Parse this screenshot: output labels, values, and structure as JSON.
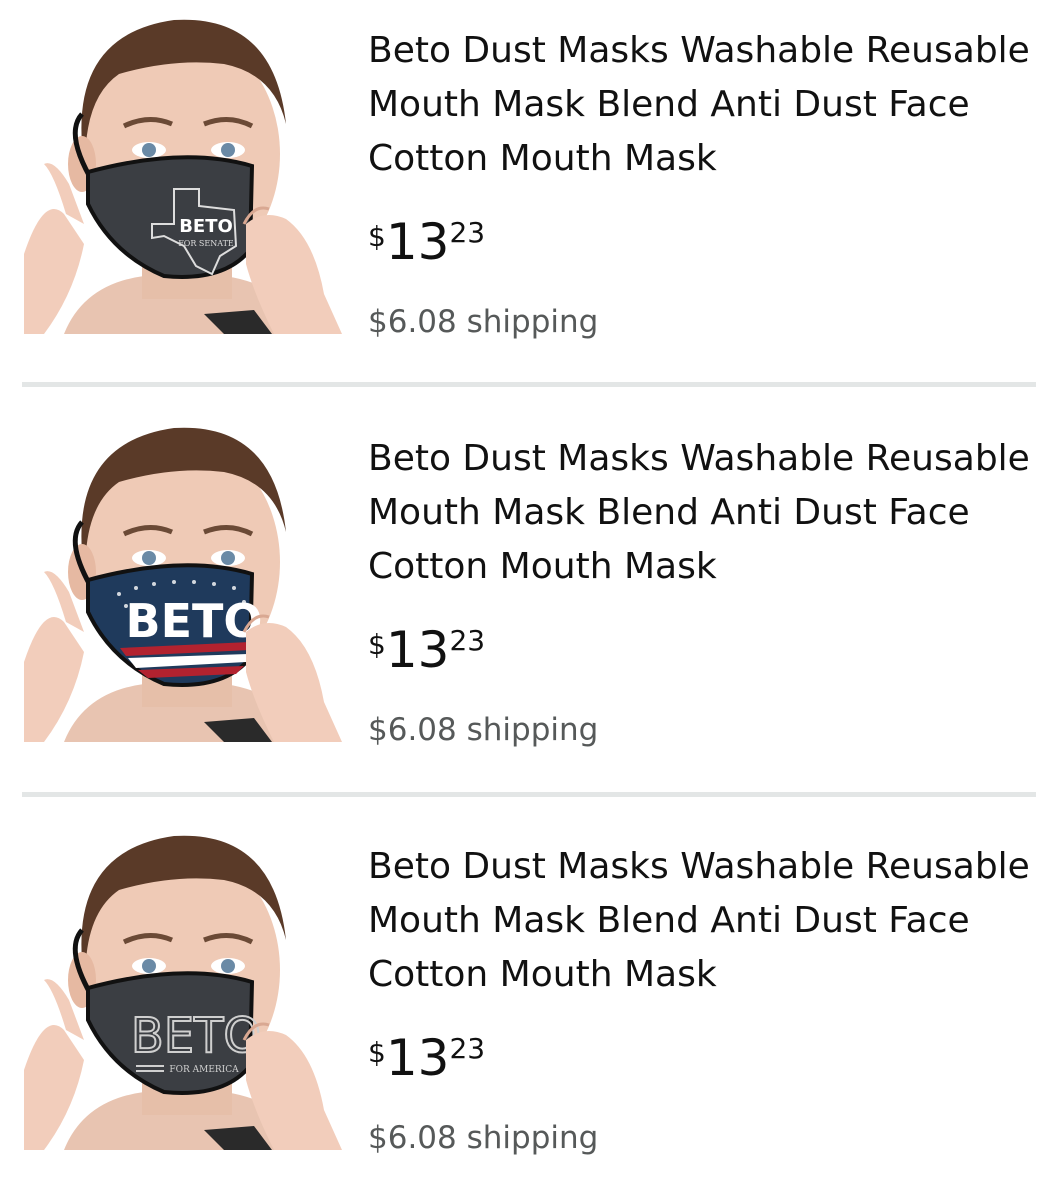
{
  "results": [
    {
      "title": "Beto Dust Masks Washable Reusable Mouth Mask Blend Anti Dust Face Cotton Mouth Mask",
      "price_symbol": "$",
      "price_whole": "13",
      "price_fraction": "23",
      "shipping": "$6.08 shipping",
      "mask_text": "BETO",
      "mask_subtext": "FOR SENATE",
      "mask_style": "texas-outline-dark"
    },
    {
      "title": "Beto Dust Masks Washable Reusable Mouth Mask Blend Anti Dust Face Cotton Mouth Mask",
      "price_symbol": "$",
      "price_whole": "13",
      "price_fraction": "23",
      "shipping": "$6.08 shipping",
      "mask_text": "BETO",
      "mask_subtext": "",
      "mask_style": "flag-stars-stripes"
    },
    {
      "title": "Beto Dust Masks Washable Reusable Mouth Mask Blend Anti Dust Face Cotton Mouth Mask",
      "price_symbol": "$",
      "price_whole": "13",
      "price_fraction": "23",
      "shipping": "$6.08 shipping",
      "mask_text": "BETO",
      "mask_subtext": "FOR AMERICA",
      "mask_style": "outlined-dark"
    }
  ],
  "colors": {
    "text": "#111111",
    "shipping": "#565959",
    "divider": "#e3e6e6",
    "mask_dark": "#3b3e43",
    "mask_blue": "#1f3a5c",
    "mask_red": "#b2222f"
  }
}
